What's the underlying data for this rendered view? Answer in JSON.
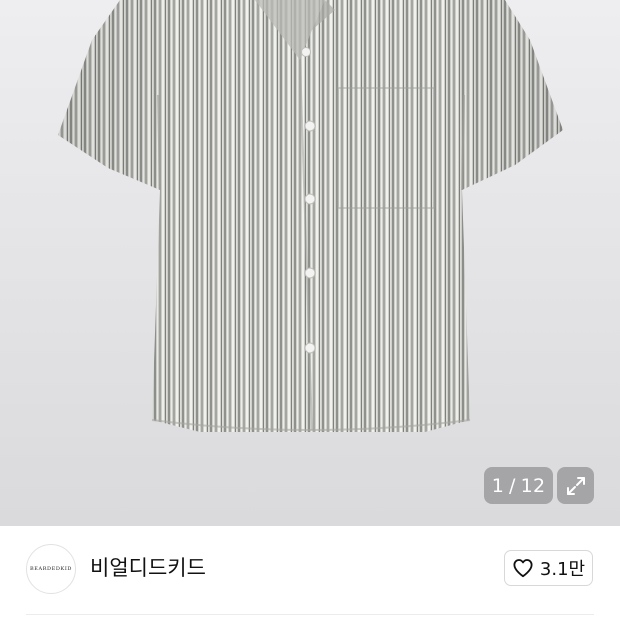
{
  "gallery": {
    "current": "1",
    "separator": "/",
    "total": "12",
    "expand_icon": "expand-icon"
  },
  "store": {
    "name": "비얼디드키드",
    "logo_text": "BEARDEDKID",
    "like_icon": "heart-icon",
    "like_count": "3.1만"
  },
  "colors": {
    "shirt_base": "#c9c9c6",
    "stripe_dark": "#8f918d",
    "stripe_light": "#ecece9",
    "counter_bg": "#78787c"
  }
}
